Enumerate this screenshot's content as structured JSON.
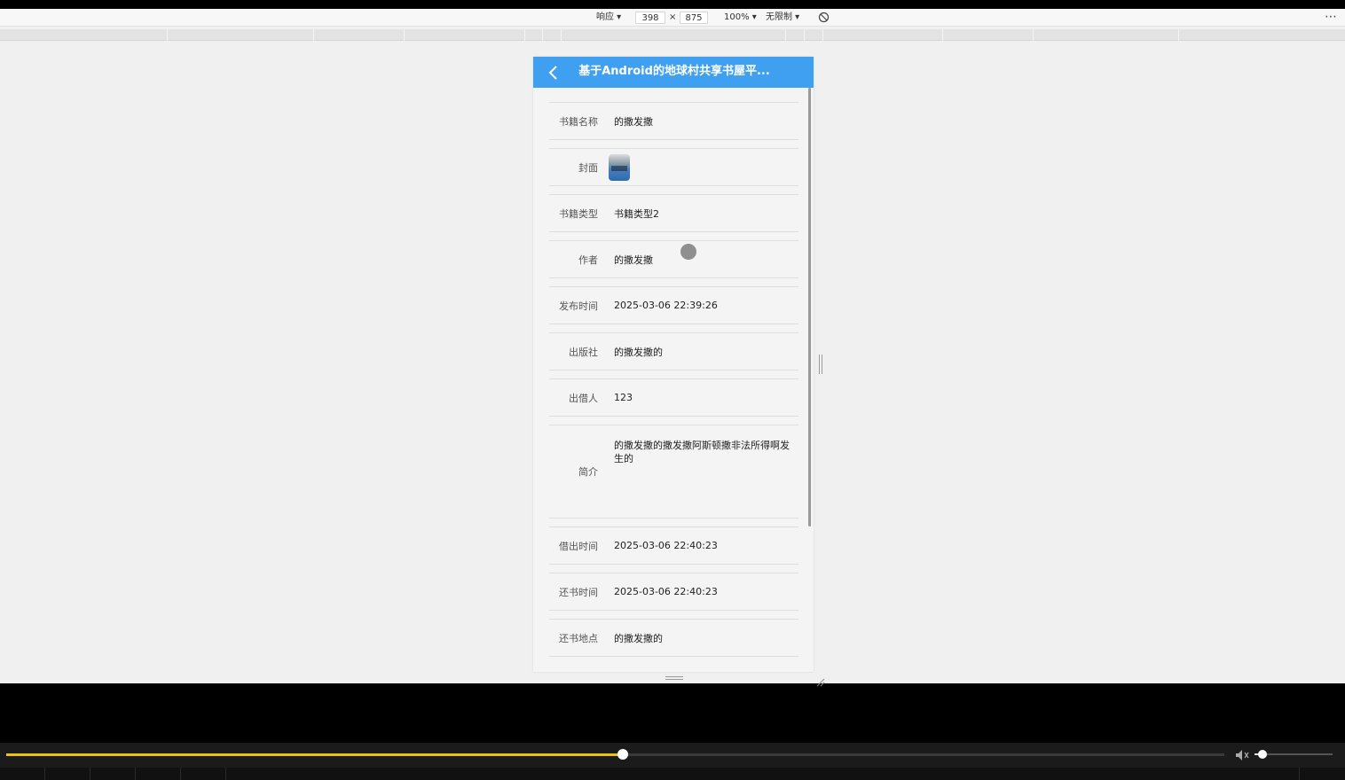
{
  "devtools": {
    "device": "响应 ▾",
    "width": "398",
    "times": "×",
    "height": "875",
    "zoom": "100% ▾",
    "throttle": "无限制 ▾",
    "more": "⋯"
  },
  "app": {
    "title": "基于Android的地球村共享书屋平...",
    "accent": "#3f9ff0"
  },
  "fields": [
    {
      "label": "书籍名称",
      "value": "的撒发撒"
    },
    {
      "label": "封面",
      "value": ""
    },
    {
      "label": "书籍类型",
      "value": "书籍类型2"
    },
    {
      "label": "作者",
      "value": "的撒发撒"
    },
    {
      "label": "发布时间",
      "value": "2025-03-06 22:39:26"
    },
    {
      "label": "出版社",
      "value": "的撒发撒的"
    },
    {
      "label": "出借人",
      "value": "123"
    },
    {
      "label": "简介",
      "value": "的撒发撒的撒发撒阿斯顿撒非法所得啊发生的"
    },
    {
      "label": "借出时间",
      "value": "2025-03-06 22:40:23"
    },
    {
      "label": "还书时间",
      "value": "2025-03-06 22:40:23"
    },
    {
      "label": "还书地点",
      "value": "的撒发撒的"
    }
  ],
  "player": {
    "progress": 0.506,
    "volume": 0.1,
    "accent": "#e6c318"
  }
}
